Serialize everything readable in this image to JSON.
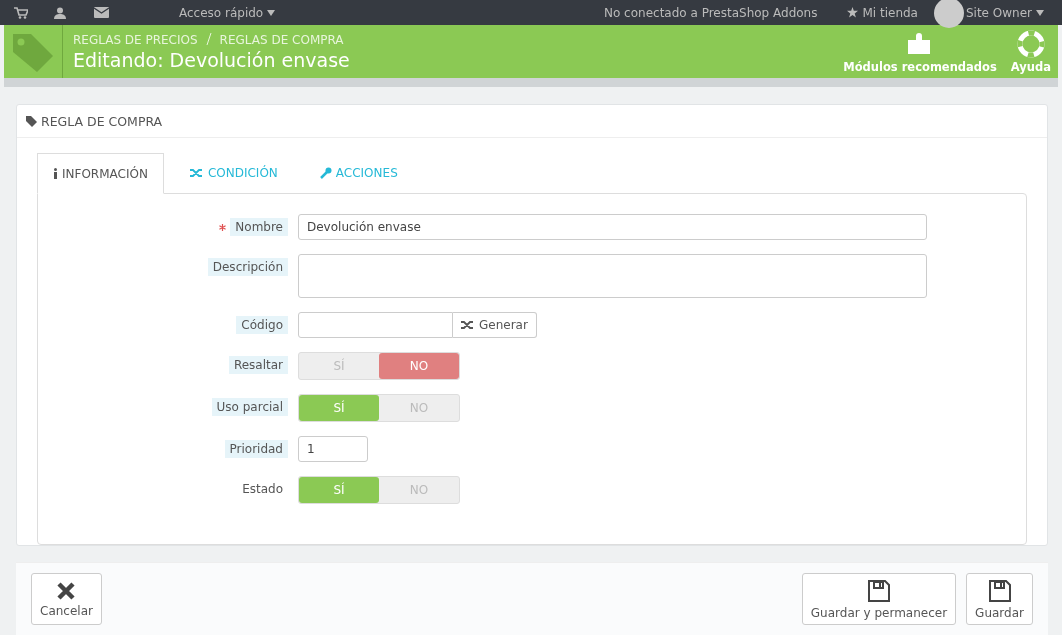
{
  "topbar": {
    "quick_access": "Acceso rápido",
    "addons": "No conectado a PrestaShop Addons",
    "shop": "Mi tienda",
    "user": "Site Owner"
  },
  "header": {
    "breadcrumb": [
      "REGLAS DE PRECIOS",
      "REGLAS DE COMPRA"
    ],
    "title": "Editando: Devolución envase",
    "actions": [
      "Módulos recomendados",
      "Ayuda"
    ]
  },
  "panel": {
    "title": "REGLA DE COMPRA",
    "tabs": [
      {
        "label": "INFORMACIÓN",
        "selected": true
      },
      {
        "label": "CONDICIÓN",
        "selected": false
      },
      {
        "label": "ACCIONES",
        "selected": false
      }
    ],
    "fields": [
      {
        "kind": "text",
        "label": "Nombre",
        "required": true,
        "hint": true,
        "value": "Devolución envase"
      },
      {
        "kind": "textarea",
        "label": "Descripción",
        "required": false,
        "hint": true
      },
      {
        "kind": "code",
        "label": "Código",
        "required": false,
        "hint": true,
        "button": "Generar"
      },
      {
        "kind": "switch",
        "label": "Resaltar",
        "required": false,
        "hint": true,
        "yes": "SÍ",
        "no": "NO",
        "on": false
      },
      {
        "kind": "switch",
        "label": "Uso parcial",
        "required": false,
        "hint": true,
        "yes": "SÍ",
        "no": "NO",
        "on": true
      },
      {
        "kind": "small",
        "label": "Prioridad",
        "required": false,
        "hint": true,
        "value": "1"
      },
      {
        "kind": "switch",
        "label": "Estado",
        "required": false,
        "hint": false,
        "yes": "SÍ",
        "no": "NO",
        "on": true
      }
    ]
  },
  "footer": {
    "cancel": "Cancelar",
    "save_stay": "Guardar y permanecer",
    "save": "Guardar"
  }
}
